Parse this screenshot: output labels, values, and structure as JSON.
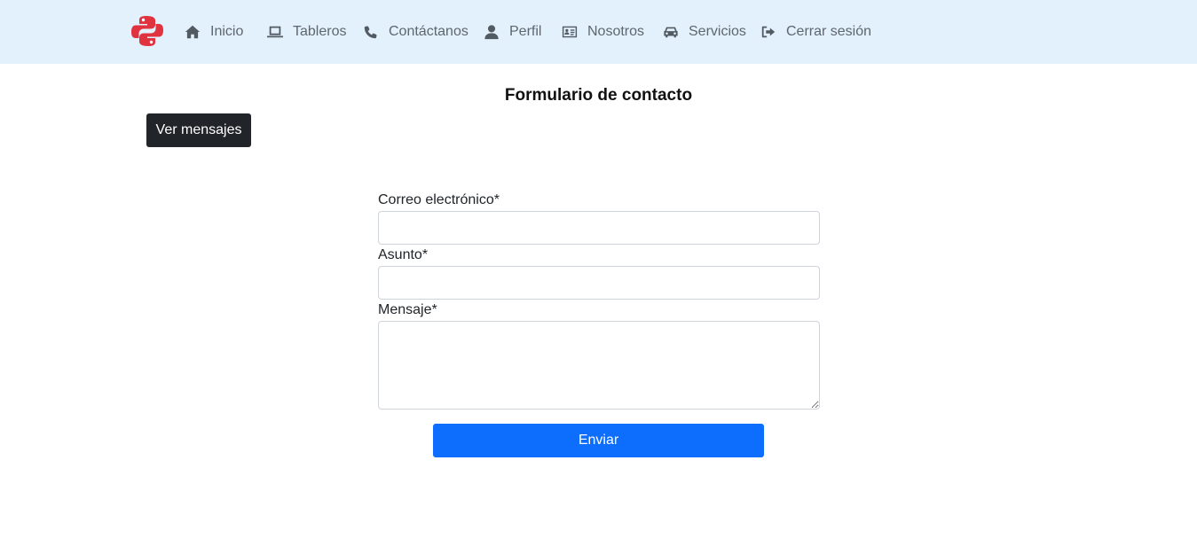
{
  "navbar": {
    "logo_icon": "python-logo-icon",
    "brand_colors": {
      "red": "#e0323f",
      "background": "#e3f1fd"
    },
    "items": [
      {
        "label": "Inicio",
        "icon": "home-icon"
      },
      {
        "label": "Tableros",
        "icon": "laptop-icon"
      },
      {
        "label": "Contáctanos",
        "icon": "phone-icon"
      },
      {
        "label": "Perfil",
        "icon": "user-icon"
      },
      {
        "label": "Nosotros",
        "icon": "id-card-icon"
      },
      {
        "label": "Servicios",
        "icon": "car-icon"
      },
      {
        "label": "Cerrar sesión",
        "icon": "sign-out-icon"
      }
    ]
  },
  "main": {
    "title": "Formulario de contacto",
    "view_messages_label": "Ver mensajes",
    "form": {
      "email_label": "Correo electrónico*",
      "email_value": "",
      "subject_label": "Asunto*",
      "subject_value": "",
      "message_label": "Mensaje*",
      "message_value": "",
      "submit_label": "Enviar",
      "submit_color": "#0d6efd"
    }
  }
}
